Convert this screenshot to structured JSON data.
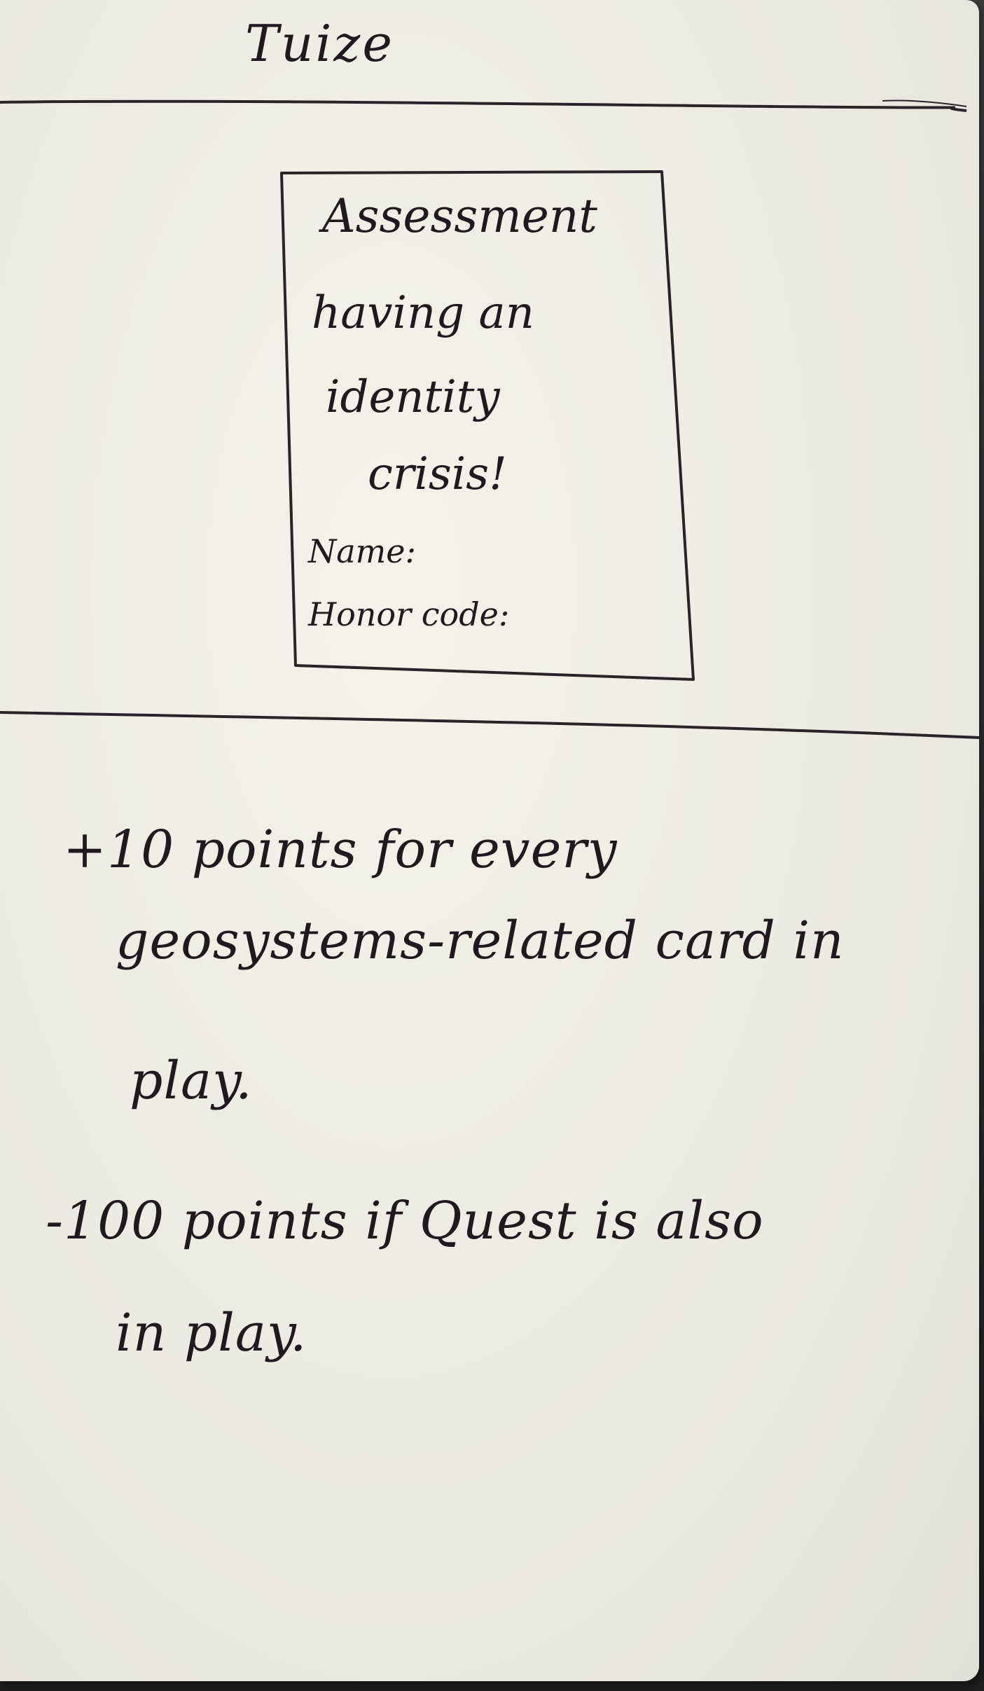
{
  "card": {
    "title": "Tuize",
    "frame": {
      "heading": "Assessment",
      "lines": [
        "having an",
        "identity",
        "crisis!"
      ],
      "fields": [
        "Name:",
        "Honor code:"
      ]
    },
    "rules": [
      [
        "+10 points for every",
        "geosystems-related card in",
        "play."
      ],
      [
        "-100 points if Quest is also",
        "in play."
      ]
    ]
  },
  "colors": {
    "paper": "#ecebe3",
    "ink": "#1f1a1f",
    "background": "#2a2a2c"
  }
}
